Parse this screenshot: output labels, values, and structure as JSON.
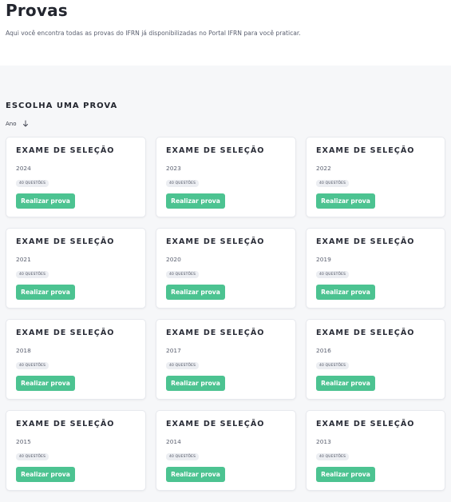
{
  "header": {
    "title": "Provas",
    "subtitle": "Aqui você encontra todas as provas do IFRN já disponibilizadas no Portal IFRN para você praticar."
  },
  "section": {
    "title": "ESCOLHA UMA PROVA",
    "sort_label": "Ano",
    "sort_icon": "arrow-down-icon"
  },
  "exams": [
    {
      "title": "EXAME DE SELEÇÃO",
      "year": "2024",
      "badge": "40 QUESTÕES",
      "button": "Realizar prova"
    },
    {
      "title": "EXAME DE SELEÇÃO",
      "year": "2023",
      "badge": "40 QUESTÕES",
      "button": "Realizar prova"
    },
    {
      "title": "EXAME DE SELEÇÃO",
      "year": "2022",
      "badge": "40 QUESTÕES",
      "button": "Realizar prova"
    },
    {
      "title": "EXAME DE SELEÇÃO",
      "year": "2021",
      "badge": "40 QUESTÕES",
      "button": "Realizar prova"
    },
    {
      "title": "EXAME DE SELEÇÃO",
      "year": "2020",
      "badge": "40 QUESTÕES",
      "button": "Realizar prova"
    },
    {
      "title": "EXAME DE SELEÇÃO",
      "year": "2019",
      "badge": "40 QUESTÕES",
      "button": "Realizar prova"
    },
    {
      "title": "EXAME DE SELEÇÃO",
      "year": "2018",
      "badge": "40 QUESTÕES",
      "button": "Realizar prova"
    },
    {
      "title": "EXAME DE SELEÇÃO",
      "year": "2017",
      "badge": "40 QUESTÕES",
      "button": "Realizar prova"
    },
    {
      "title": "EXAME DE SELEÇÃO",
      "year": "2016",
      "badge": "40 QUESTÕES",
      "button": "Realizar prova"
    },
    {
      "title": "EXAME DE SELEÇÃO",
      "year": "2015",
      "badge": "40 QUESTÕES",
      "button": "Realizar prova"
    },
    {
      "title": "EXAME DE SELEÇÃO",
      "year": "2014",
      "badge": "40 QUESTÕES",
      "button": "Realizar prova"
    },
    {
      "title": "EXAME DE SELEÇÃO",
      "year": "2013",
      "badge": "40 QUESTÕES",
      "button": "Realizar prova"
    }
  ],
  "colors": {
    "accent": "#4cc391",
    "background": "#f6f7f9",
    "card": "#ffffff"
  }
}
